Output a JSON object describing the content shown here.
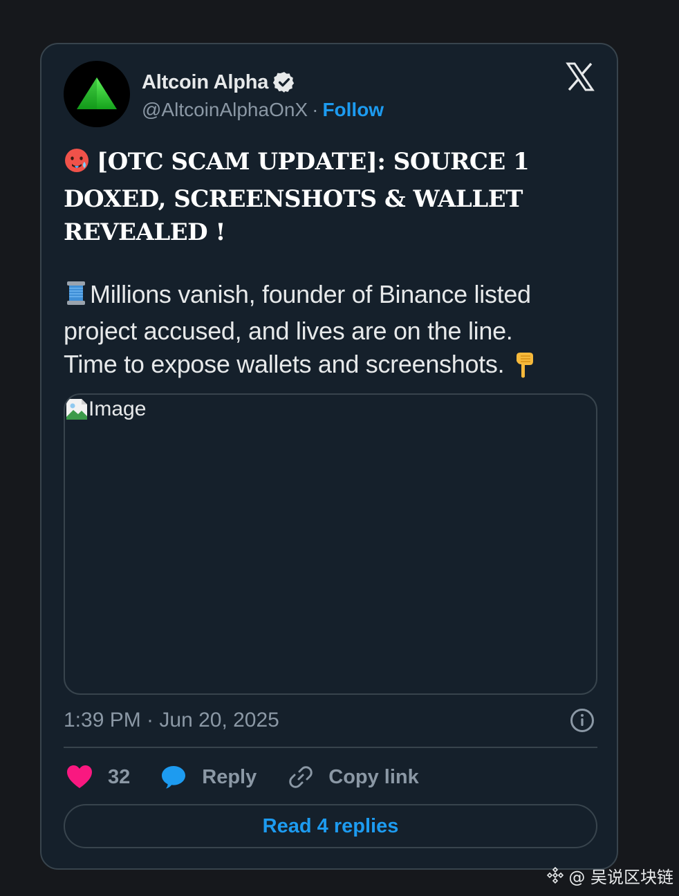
{
  "tweet": {
    "author": {
      "display_name": "Altcoin Alpha",
      "handle": "@AltcoinAlphaOnX",
      "separator": "·",
      "follow_label": "Follow",
      "verified": true
    },
    "headline_emoji": "🥵",
    "headline": "[OTC SCAM UPDATE]: SOURCE 1 DOXED, SCREENSHOTS & WALLET REVEALED !",
    "body_emoji": "🧵",
    "body_lines": [
      "Millions vanish, founder of Binance listed",
      "project accused, and lives are on the line.",
      "Time to expose wallets and screenshots."
    ],
    "body_end_emoji": "👇",
    "media_alt": "Image",
    "timestamp": "1:39 PM · Jun 20, 2025",
    "likes_count": "32",
    "reply_label": "Reply",
    "copy_link_label": "Copy link",
    "read_replies_label": "Read 4 replies"
  },
  "watermark": {
    "text": "@ 吴说区块链"
  },
  "colors": {
    "page_bg": "#16181c",
    "card_bg": "#15202b",
    "border": "#38444d",
    "accent": "#1d9bf0",
    "like": "#f91880",
    "muted": "#8b98a5"
  },
  "icons": {
    "avatar": "green-triangle-logo",
    "verified": "verified-badge-icon",
    "brand": "x-logo-icon",
    "info": "info-icon",
    "like": "heart-icon",
    "reply": "speech-bubble-icon",
    "copy": "link-icon"
  }
}
